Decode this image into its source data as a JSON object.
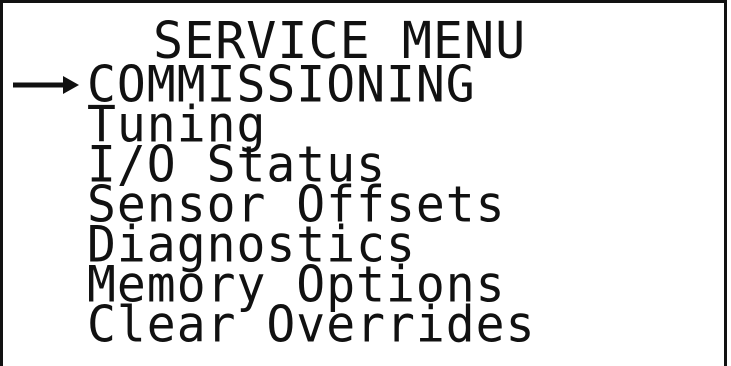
{
  "screen": {
    "title": "SERVICE MENU",
    "cursor_icon": "right-arrow-icon",
    "selected_index": 0,
    "items": [
      {
        "label": "COMMISSIONING"
      },
      {
        "label": "Tuning"
      },
      {
        "label": "I/O Status"
      },
      {
        "label": "Sensor Offsets"
      },
      {
        "label": "Diagnostics"
      },
      {
        "label": "Memory Options"
      },
      {
        "label": "Clear Overrides"
      }
    ]
  }
}
